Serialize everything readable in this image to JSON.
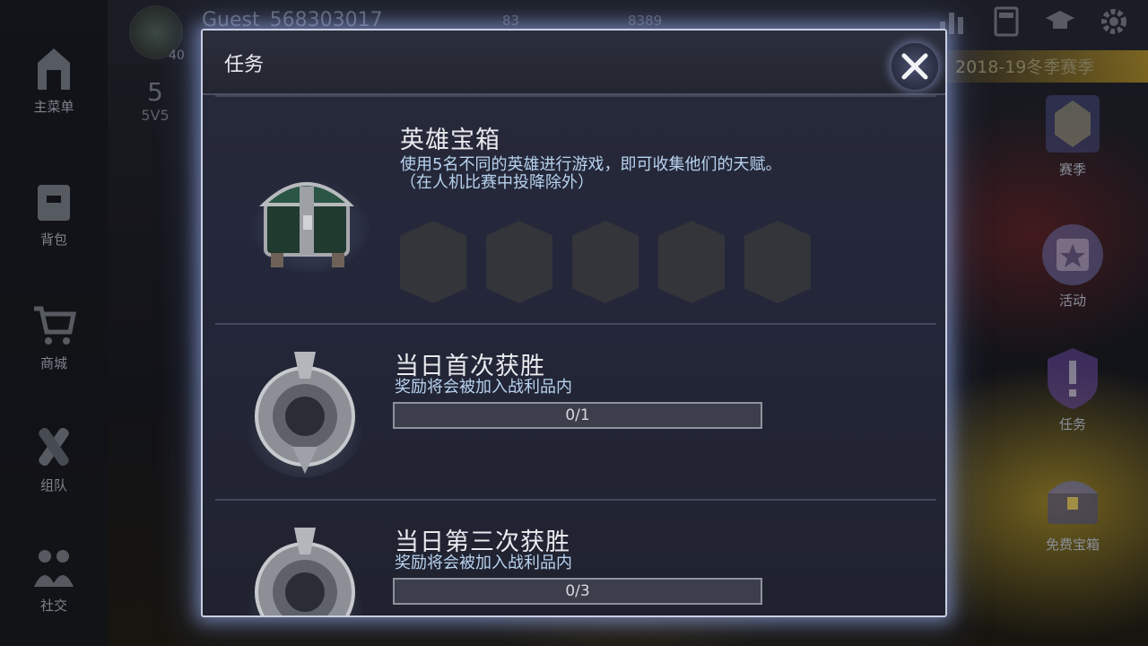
{
  "background": {
    "username": "Guest_568303017",
    "player_level": "40",
    "currency_1": "83",
    "currency_2": "8389",
    "season_banner": "2018-19冬季赛季",
    "rank": {
      "number": "5",
      "mode": "5V5"
    },
    "left_nav": [
      {
        "label": "主菜单",
        "icon": "home-icon"
      },
      {
        "label": "背包",
        "icon": "backpack-icon"
      },
      {
        "label": "商城",
        "icon": "cart-icon"
      },
      {
        "label": "组队",
        "icon": "team-icon"
      },
      {
        "label": "社交",
        "icon": "social-icon"
      }
    ],
    "right_nav": [
      {
        "label": "赛季",
        "icon": "season-helmet-icon"
      },
      {
        "label": "活动",
        "icon": "calendar-star-icon"
      },
      {
        "label": "任务",
        "icon": "quest-shield-icon"
      },
      {
        "label": "免费宝箱",
        "icon": "free-chest-icon"
      }
    ]
  },
  "modal": {
    "title": "任务",
    "close_icon": "close-icon",
    "quests": [
      {
        "name": "英雄宝箱",
        "description": "使用5名不同的英雄进行游戏，即可收集他们的天赋。（在人机比赛中投降除外）",
        "icon": "treasure-chest-icon",
        "slots_total": 5,
        "slots_filled": 0
      },
      {
        "name": "当日首次获胜",
        "description": "奖励将会被加入战利品内",
        "icon": "victory-medal-icon",
        "progress_text": "0/1",
        "progress_fraction": 0
      },
      {
        "name": "当日第三次获胜",
        "description": "奖励将会被加入战利品内",
        "icon": "victory-medal-icon",
        "progress_text": "0/3",
        "progress_fraction": 0
      }
    ]
  }
}
